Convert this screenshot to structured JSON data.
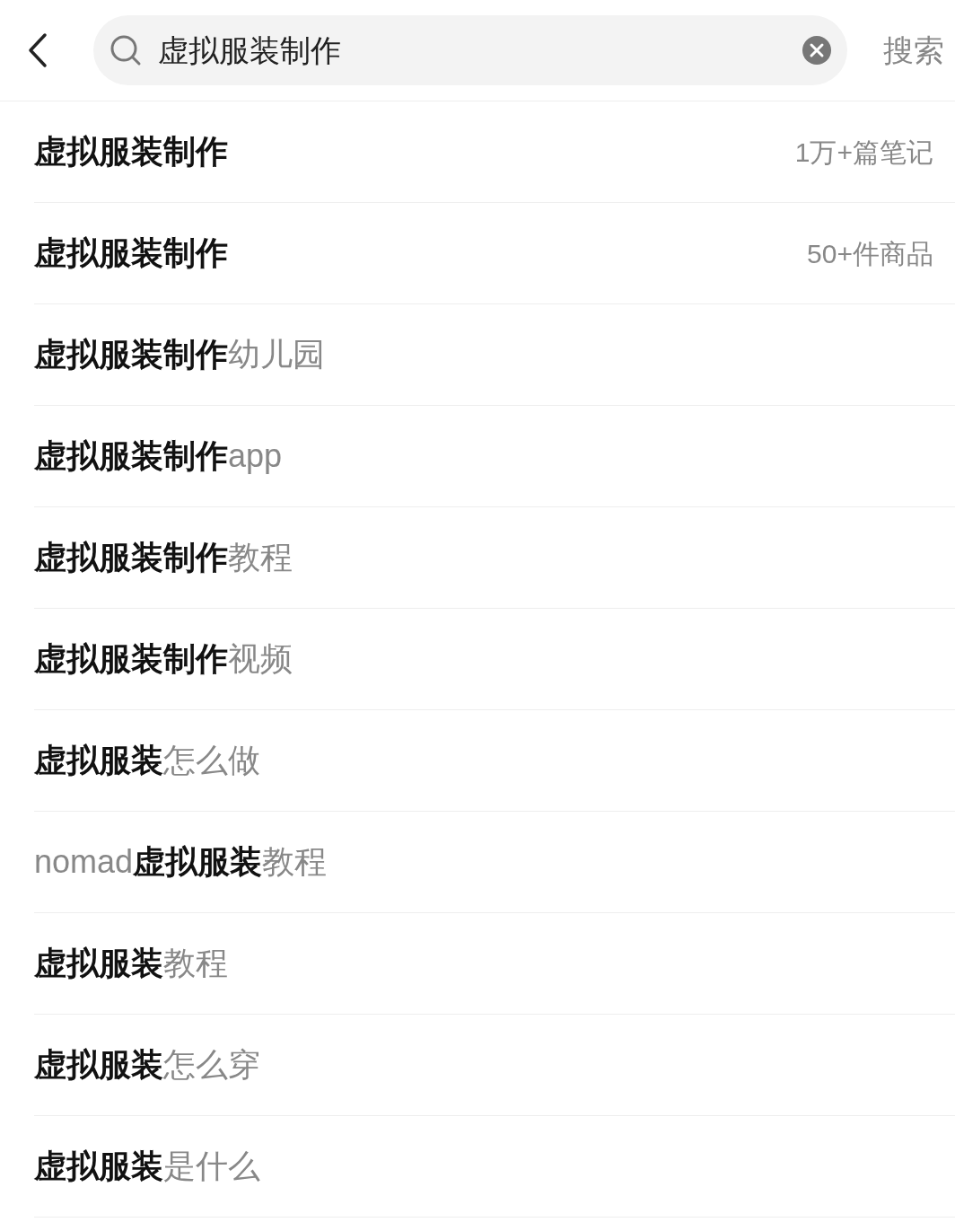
{
  "search": {
    "value": "虚拟服装制作",
    "submit": "搜索"
  },
  "suggestions": [
    {
      "text": "**虚拟服装制作**",
      "count": "1万+篇笔记"
    },
    {
      "text": "**虚拟服装制作**",
      "count": "50+件商品"
    },
    {
      "text": "**虚拟服装制作**幼儿园"
    },
    {
      "text": "**虚拟服装制作**app"
    },
    {
      "text": "**虚拟服装制作**教程"
    },
    {
      "text": "**虚拟服装制作**视频"
    },
    {
      "text": "**虚拟服装**怎么做"
    },
    {
      "text": "nomad**虚拟服装**教程"
    },
    {
      "text": "**虚拟服装**教程"
    },
    {
      "text": "**虚拟服装**怎么穿"
    },
    {
      "text": "**虚拟服装**是什么"
    }
  ]
}
